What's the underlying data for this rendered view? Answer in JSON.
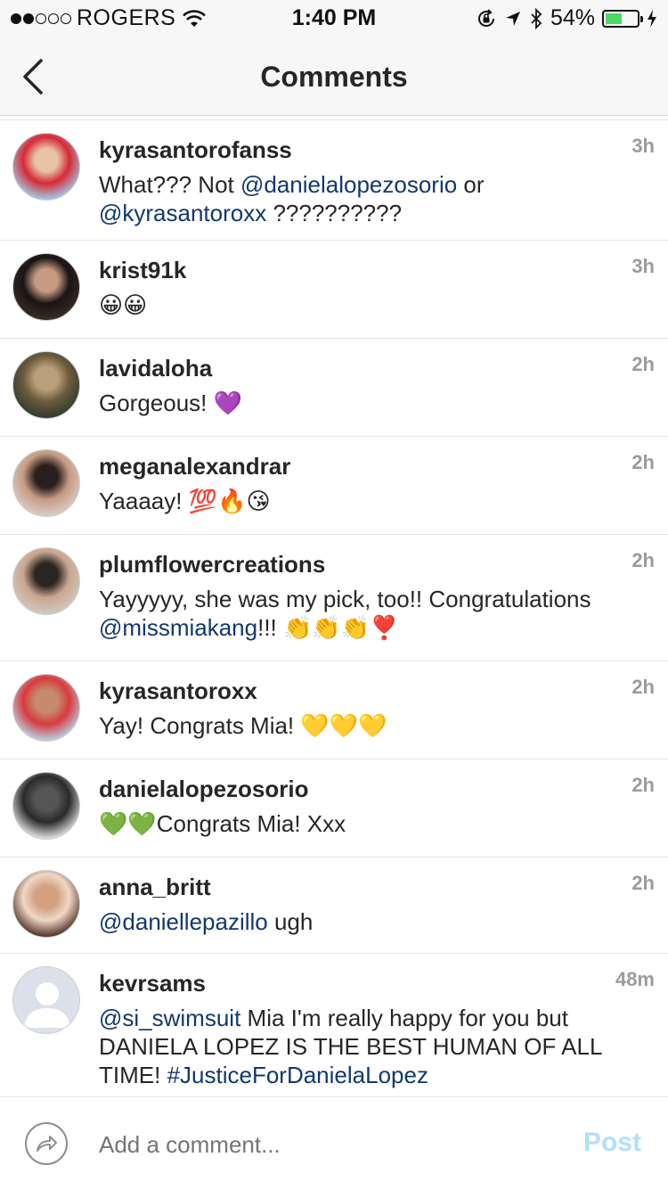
{
  "status_bar": {
    "carrier": "ROGERS",
    "time": "1:40 PM",
    "battery_pct": "54%",
    "battery_level": 0.54,
    "signal_bars_filled": 2,
    "signal_bars_total": 5
  },
  "nav": {
    "title": "Comments",
    "back_icon": "chevron-left-icon"
  },
  "comments": [
    {
      "username": "kyrasantorofanss",
      "time": "3h",
      "avatar_colors": [
        "#9fd0ef",
        "#e8c3a5",
        "#d62a36"
      ],
      "segments": [
        {
          "t": "What??? Not "
        },
        {
          "t": "@danielalopezosorio",
          "m": true
        },
        {
          "t": " or "
        },
        {
          "t": "@kyrasantoroxx",
          "m": true
        },
        {
          "t": " ??????????"
        }
      ]
    },
    {
      "username": "krist91k",
      "time": "3h",
      "avatar_colors": [
        "#3b2c26",
        "#c79a84",
        "#1a1414"
      ],
      "segments": [
        {
          "t": "😀😀"
        }
      ]
    },
    {
      "username": "lavidaloha",
      "time": "2h",
      "avatar_colors": [
        "#2f3a2c",
        "#b9a07a",
        "#6c5a3d"
      ],
      "segments": [
        {
          "t": "Gorgeous! 💜"
        }
      ]
    },
    {
      "username": "meganalexandrar",
      "time": "2h",
      "avatar_colors": [
        "#d8cfc8",
        "#2a1f1c",
        "#c79b84"
      ],
      "segments": [
        {
          "t": "Yaaaay! 💯🔥😘"
        }
      ]
    },
    {
      "username": "plumflowercreations",
      "time": "2h",
      "avatar_colors": [
        "#cfc9c2",
        "#2b2522",
        "#caa68f"
      ],
      "segments": [
        {
          "t": "Yayyyyy, she was my pick, too!! Congratulations "
        },
        {
          "t": "@missmiakang",
          "m": true
        },
        {
          "t": "!!! 👏👏👏❣️"
        }
      ]
    },
    {
      "username": "kyrasantoroxx",
      "time": "2h",
      "avatar_colors": [
        "#b6d7ea",
        "#c68a6c",
        "#d83a3f"
      ],
      "segments": [
        {
          "t": "Yay! Congrats Mia! 💛💛💛"
        }
      ]
    },
    {
      "username": "danielalopezosorio",
      "time": "2h",
      "avatar_colors": [
        "#e8e8e8",
        "#555555",
        "#2a2a2a"
      ],
      "segments": [
        {
          "t": "💚💚Congrats Mia! Xxx"
        }
      ]
    },
    {
      "username": "anna_britt",
      "time": "2h",
      "avatar_colors": [
        "#4a2c22",
        "#d3a181",
        "#f1d7c6"
      ],
      "segments": [
        {
          "t": "@daniellepazillo",
          "m": true
        },
        {
          "t": " ugh"
        }
      ]
    },
    {
      "username": "kevrsams",
      "time": "48m",
      "avatar_colors": [
        "#dbe0ea",
        "#ffffff",
        "#ffffff"
      ],
      "default_avatar": true,
      "segments": [
        {
          "t": "@si_swimsuit",
          "m": true
        },
        {
          "t": " Mia I'm really happy for you but DANIELA LOPEZ IS THE BEST HUMAN OF ALL TIME! "
        },
        {
          "t": "#JusticeForDanielaLopez",
          "m": true
        }
      ]
    }
  ],
  "composer": {
    "placeholder": "Add a comment...",
    "post_label": "Post",
    "share_icon": "share-arrow-icon"
  },
  "colors": {
    "mention": "#12386b",
    "timestamp": "#9b9b9b",
    "post_disabled": "#b2dffc"
  }
}
